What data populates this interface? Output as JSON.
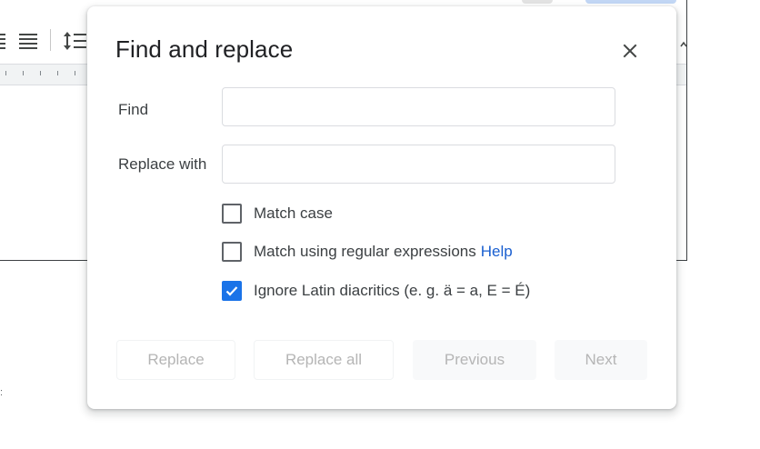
{
  "dialog": {
    "title": "Find and replace",
    "find_label": "Find",
    "find_value": "",
    "find_placeholder": "",
    "replace_label": "Replace with",
    "replace_value": "",
    "replace_placeholder": "",
    "options": [
      {
        "label": "Match case",
        "checked": false
      },
      {
        "label": "Match using regular expressions",
        "checked": false,
        "link": "Help"
      },
      {
        "label": "Ignore Latin diacritics (e. g. ä = a, E = É)",
        "checked": true
      }
    ],
    "buttons": {
      "replace": "Replace",
      "replace_all": "Replace all",
      "previous": "Previous",
      "next": "Next"
    }
  },
  "icons": {
    "close": "close-icon",
    "check": "check-icon",
    "justify": "align-justify-icon",
    "line_spacing": "line-spacing-icon"
  },
  "colors": {
    "accent": "#1a73e8",
    "link": "#1a5fd0",
    "text": "#202124",
    "disabled_text": "#b5b5b5"
  }
}
